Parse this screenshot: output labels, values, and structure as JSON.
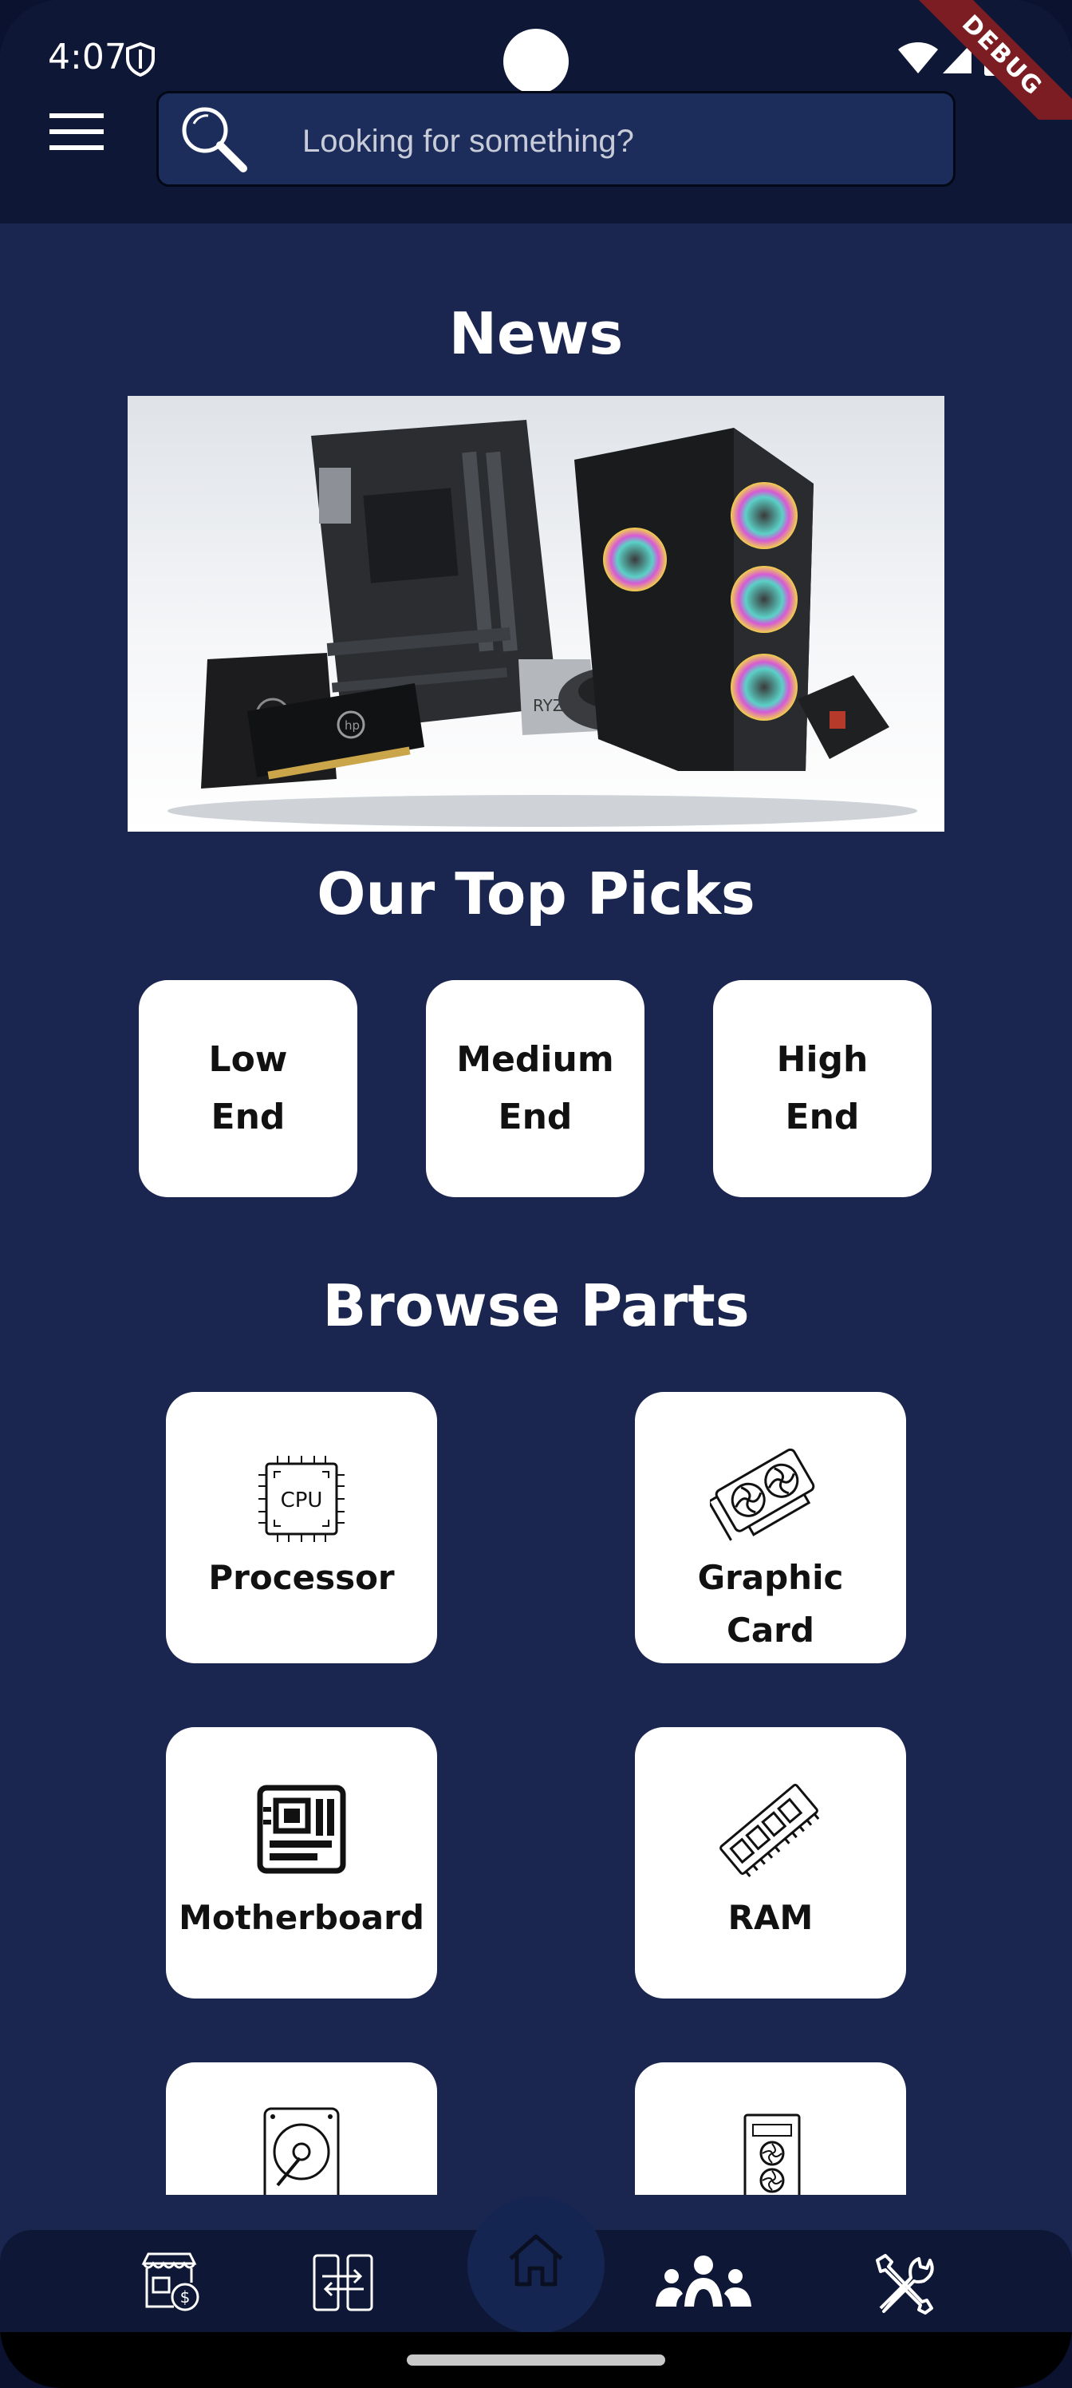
{
  "status_bar": {
    "time": "4:07",
    "debug_label": "DEBUG"
  },
  "search": {
    "placeholder": "Looking for something?"
  },
  "news": {
    "title": "News",
    "image_brands": [
      "hp",
      "hp",
      "RYZEN"
    ]
  },
  "top_picks": {
    "title": "Our Top Picks",
    "items": [
      {
        "label": "Low\nEnd"
      },
      {
        "label": "Medium\nEnd"
      },
      {
        "label": "High\nEnd"
      }
    ]
  },
  "browse_parts": {
    "title": "Browse Parts",
    "items": [
      {
        "label": "Processor",
        "icon": "cpu-icon",
        "icon_text": "CPU"
      },
      {
        "label": "Graphic\nCard",
        "icon": "graphics-card-icon"
      },
      {
        "label": "Motherboard",
        "icon": "motherboard-icon"
      },
      {
        "label": "RAM",
        "icon": "ram-icon"
      },
      {
        "label": "",
        "icon": "hard-drive-icon"
      },
      {
        "label": "",
        "icon": "pc-case-icon"
      }
    ]
  },
  "bottom_nav": {
    "items": [
      {
        "icon": "store-price-icon"
      },
      {
        "icon": "compare-phones-icon"
      },
      {
        "icon": "home-icon",
        "active": true
      },
      {
        "icon": "community-icon"
      },
      {
        "icon": "tools-icon"
      }
    ]
  },
  "colors": {
    "background": "#1a2550",
    "app_bar": "#0e1836",
    "search_bar": "#1c2d5c",
    "card": "#ffffff",
    "title_text": "#ffffff",
    "card_text": "#111111",
    "debug_ribbon": "#7c1d24"
  }
}
